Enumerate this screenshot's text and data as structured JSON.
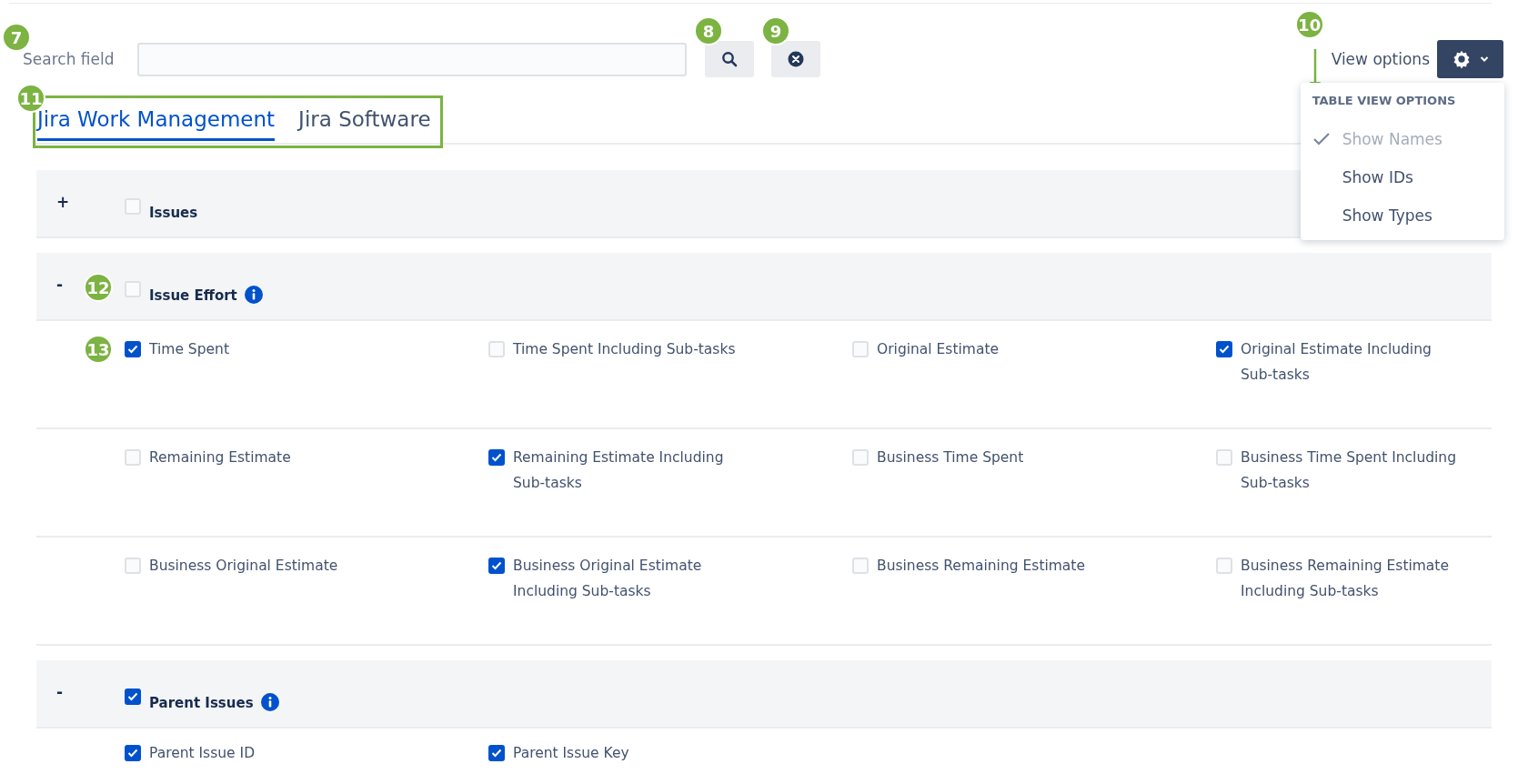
{
  "search": {
    "label": "Search field",
    "callout": "7",
    "search_button_callout": "8",
    "clear_button_callout": "9"
  },
  "view_options": {
    "label": "View options",
    "callout": "10",
    "menu": {
      "heading": "TABLE VIEW OPTIONS",
      "items": [
        {
          "label": "Show Names",
          "selected": true
        },
        {
          "label": "Show IDs",
          "selected": false
        },
        {
          "label": "Show Types",
          "selected": false
        }
      ]
    }
  },
  "tabs_callout": "11",
  "tabs": [
    {
      "label": "Jira Work Management",
      "selected": true
    },
    {
      "label": "Jira Software",
      "selected": false
    }
  ],
  "groups": [
    {
      "toggle": "+",
      "label": "Issues",
      "checked": false,
      "info": false
    },
    {
      "toggle": "-",
      "label": "Issue Effort",
      "checked": false,
      "info": true,
      "callout": "12",
      "field_callout": "13",
      "fields": [
        {
          "label": "Time Spent",
          "checked": true
        },
        {
          "label": "Time Spent Including Sub-tasks",
          "checked": false
        },
        {
          "label": "Original Estimate",
          "checked": false
        },
        {
          "label": "Original Estimate Including Sub-tasks",
          "checked": true
        },
        {
          "label": "Remaining Estimate",
          "checked": false
        },
        {
          "label": "Remaining Estimate Including Sub-tasks",
          "checked": true
        },
        {
          "label": "Business Time Spent",
          "checked": false
        },
        {
          "label": "Business Time Spent Including Sub-tasks",
          "checked": false
        },
        {
          "label": "Business Original Estimate",
          "checked": false
        },
        {
          "label": "Business Original Estimate Including Sub-tasks",
          "checked": true
        },
        {
          "label": "Business Remaining Estimate",
          "checked": false
        },
        {
          "label": "Business Remaining Estimate Including Sub-tasks",
          "checked": false
        }
      ]
    },
    {
      "toggle": "-",
      "label": "Parent Issues",
      "checked": true,
      "info": true,
      "fields": [
        {
          "label": "Parent Issue ID",
          "checked": true
        },
        {
          "label": "Parent Issue Key",
          "checked": true
        }
      ]
    }
  ]
}
